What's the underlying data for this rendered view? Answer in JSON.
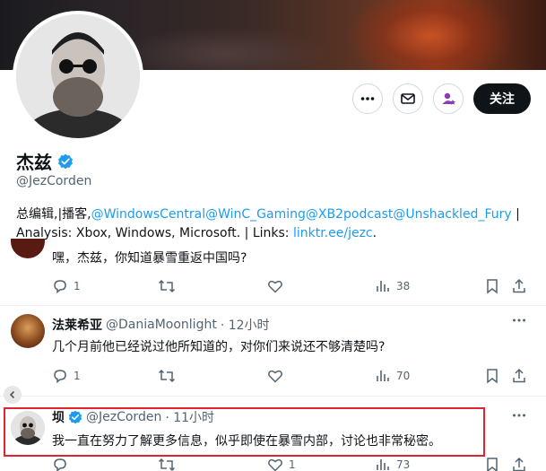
{
  "profile": {
    "name": "杰兹",
    "handle": "@JezCorden",
    "follow_label": "关注",
    "bio_prefix": "总编辑,|播客,",
    "bio_mentions": "@WindowsCentral@WinC_Gaming@XB2podcast@Unshackled_Fury",
    "bio_suffix": " |",
    "bio_line2": "Analysis: Xbox, Windows, Microsoft. | Links: ",
    "bio_link": "linktr.ee/jezc",
    "bio_end": "."
  },
  "tweets": [
    {
      "text": "嘿，杰兹，你知道暴雪重返中国吗?",
      "replies": "1",
      "views": "38"
    },
    {
      "name": "法莱希亚",
      "handle": "@DaniaMoonlight",
      "time": "· 12小时",
      "text": "几个月前他已经说过他所知道的，对你们来说还不够清楚吗?",
      "replies": "1",
      "views": "70"
    },
    {
      "name": "坝",
      "handle": "@JezCorden",
      "time": "· 11小时",
      "text": "我一直在努力了解更多信息，似乎即使在暴雪内部，讨论也非常秘密。",
      "replies": "",
      "likes": "1",
      "views": "73"
    }
  ],
  "icons": [
    "more-icon",
    "mail-icon",
    "subscribe-icon",
    "verified-icon",
    "reply-icon",
    "retweet-icon",
    "like-icon",
    "views-icon",
    "bookmark-icon",
    "share-icon",
    "chevron-left-icon"
  ],
  "colors": {
    "accent": "#1d9bf0",
    "highlight": "#e0242e",
    "follow_bg": "#0f1419"
  }
}
